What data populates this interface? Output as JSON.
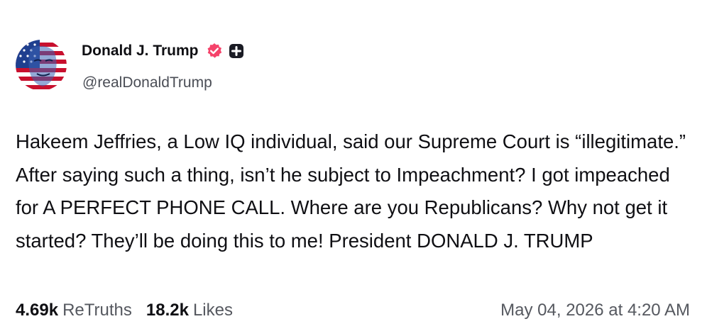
{
  "author": {
    "display_name": "Donald J. Trump",
    "handle": "@realDonaldTrump",
    "verified_icon": "verified-badge-icon",
    "plus_icon": "plus-badge-icon"
  },
  "post": {
    "text": "Hakeem Jeffries, a Low IQ individual, said our Supreme Court is “illegitimate.” After saying such a thing, isn’t he subject to Impeachment? I got impeached for A PERFECT PHONE CALL. Where are you Republicans? Why not get it started? They’ll be doing this to me! President DONALD J. TRUMP"
  },
  "stats": {
    "retruths_count": "4.69k",
    "retruths_label": "ReTruths",
    "likes_count": "18.2k",
    "likes_label": "Likes"
  },
  "timestamp": "May 04, 2026 at 4:20 AM",
  "colors": {
    "verified_pink": "#f5436a",
    "text_primary": "#0f0f13",
    "text_secondary": "#55585f"
  }
}
